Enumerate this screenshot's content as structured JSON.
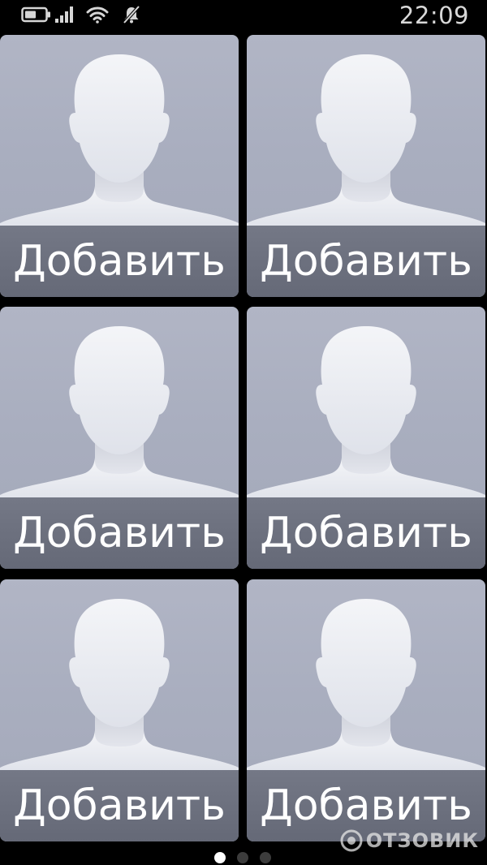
{
  "status_bar": {
    "time": "22:09",
    "icons": [
      "battery-icon",
      "signal-icon",
      "wifi-icon",
      "notifications-muted-icon"
    ]
  },
  "contacts_grid": {
    "tiles": [
      {
        "label": "Добавить",
        "icon": "person-silhouette-icon"
      },
      {
        "label": "Добавить",
        "icon": "person-silhouette-icon"
      },
      {
        "label": "Добавить",
        "icon": "person-silhouette-icon"
      },
      {
        "label": "Добавить",
        "icon": "person-silhouette-icon"
      },
      {
        "label": "Добавить",
        "icon": "person-silhouette-icon"
      },
      {
        "label": "Добавить",
        "icon": "person-silhouette-icon"
      }
    ]
  },
  "pager": {
    "page_count": 3,
    "current_page": 1
  },
  "watermark": {
    "text": "ОТЗОВИК"
  },
  "colors": {
    "background": "#000000",
    "tile": "#aeb2c2",
    "label_bar": "#6d717f",
    "label_text": "#ffffff",
    "silhouette": "#eef0f5"
  }
}
